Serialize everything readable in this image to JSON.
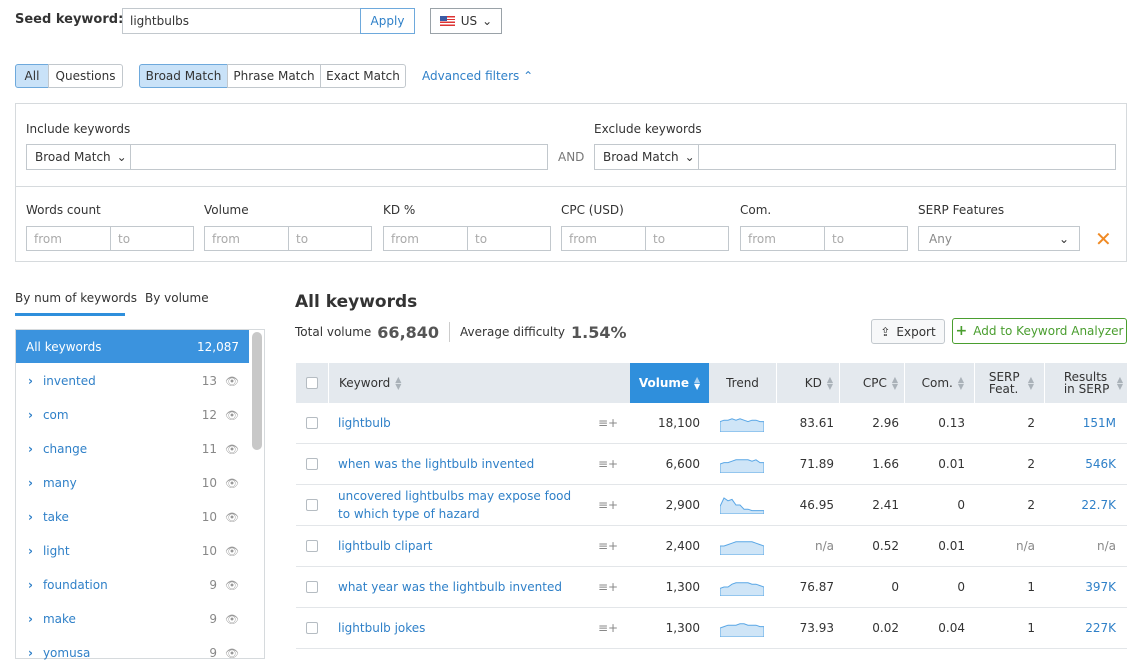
{
  "seed": {
    "label": "Seed keyword:",
    "value": "lightbulbs",
    "apply": "Apply",
    "country": "US"
  },
  "tabs1": [
    "All",
    "Questions"
  ],
  "tabs2": [
    "Broad Match",
    "Phrase Match",
    "Exact Match"
  ],
  "advanced": "Advanced filters",
  "filters": {
    "include": "Include keywords",
    "exclude": "Exclude keywords",
    "match": "Broad Match",
    "and": "AND",
    "ranges": [
      {
        "label": "Words count",
        "from": "from",
        "to": "to"
      },
      {
        "label": "Volume",
        "from": "from",
        "to": "to"
      },
      {
        "label": "KD %",
        "from": "from",
        "to": "to"
      },
      {
        "label": "CPC (USD)",
        "from": "from",
        "to": "to"
      },
      {
        "label": "Com.",
        "from": "from",
        "to": "to"
      }
    ],
    "serp_label": "SERP Features",
    "serp_value": "Any"
  },
  "sidebar": {
    "tabs": [
      "By num of keywords",
      "By volume"
    ],
    "all_label": "All keywords",
    "all_count": "12,087",
    "items": [
      {
        "label": "invented",
        "count": "13"
      },
      {
        "label": "com",
        "count": "12"
      },
      {
        "label": "change",
        "count": "11"
      },
      {
        "label": "many",
        "count": "10"
      },
      {
        "label": "take",
        "count": "10"
      },
      {
        "label": "light",
        "count": "10"
      },
      {
        "label": "foundation",
        "count": "9"
      },
      {
        "label": "make",
        "count": "9"
      },
      {
        "label": "yomusa",
        "count": "9"
      }
    ]
  },
  "main": {
    "title": "All keywords",
    "total_label": "Total volume",
    "total": "66,840",
    "diff_label": "Average difficulty",
    "diff": "1.54%",
    "export": "Export",
    "add": "Add to Keyword Analyzer"
  },
  "colors": {
    "accent": "#2f8fdc",
    "link": "#2f80c8",
    "green": "#4a9e2f",
    "orange": "#f08a24"
  },
  "table": {
    "headers": [
      "Keyword",
      "Volume",
      "Trend",
      "KD",
      "CPC",
      "Com.",
      "SERP Feat.",
      "Results in SERP"
    ],
    "rows": [
      {
        "keyword": "lightbulb",
        "volume": "18,100",
        "trend": [
          6,
          7,
          7,
          8,
          7,
          8,
          7,
          6,
          7,
          7,
          6,
          6
        ],
        "kd": "83.61",
        "cpc": "2.96",
        "com": "0.13",
        "serp": "2",
        "results": "151M"
      },
      {
        "keyword": "when was the lightbulb invented",
        "volume": "6,600",
        "trend": [
          5,
          6,
          6,
          7,
          8,
          8,
          8,
          8,
          7,
          8,
          6,
          6
        ],
        "kd": "71.89",
        "cpc": "1.66",
        "com": "0.01",
        "serp": "2",
        "results": "546K"
      },
      {
        "keyword": "uncovered lightbulbs may expose food to which type of hazard",
        "volume": "2,900",
        "trend": [
          4,
          10,
          8,
          9,
          5,
          5,
          2,
          2,
          1,
          1,
          1,
          1
        ],
        "kd": "46.95",
        "cpc": "2.41",
        "com": "0",
        "serp": "2",
        "results": "22.7K"
      },
      {
        "keyword": "lightbulb clipart",
        "volume": "2,400",
        "trend": [
          5,
          5,
          6,
          7,
          8,
          8,
          8,
          8,
          8,
          7,
          6,
          5
        ],
        "kd": "n/a",
        "cpc": "0.52",
        "com": "0.01",
        "serp": "n/a",
        "results": "n/a"
      },
      {
        "keyword": "what year was the lightbulb invented",
        "volume": "1,300",
        "trend": [
          4,
          5,
          5,
          7,
          8,
          8,
          8,
          8,
          7,
          7,
          6,
          5
        ],
        "kd": "76.87",
        "cpc": "0",
        "com": "0",
        "serp": "1",
        "results": "397K"
      },
      {
        "keyword": "lightbulb jokes",
        "volume": "1,300",
        "trend": [
          5,
          6,
          7,
          7,
          7,
          8,
          8,
          7,
          7,
          7,
          6,
          6
        ],
        "kd": "73.93",
        "cpc": "0.02",
        "com": "0.04",
        "serp": "1",
        "results": "227K"
      }
    ]
  }
}
